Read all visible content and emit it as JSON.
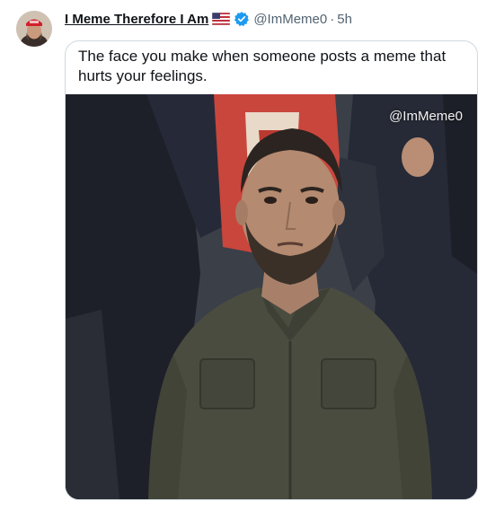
{
  "tweet": {
    "display_name": "I Meme Therefore I Am",
    "handle": "@ImMeme0",
    "separator": "·",
    "time": "5h",
    "flag_icon": "us-flag-icon",
    "verified_icon": "verified-badge-icon",
    "verified_color": "#1d9bf0"
  },
  "quote": {
    "caption": "The face you make when someone posts a meme that hurts your feelings.",
    "watermark": "@ImMeme0"
  }
}
